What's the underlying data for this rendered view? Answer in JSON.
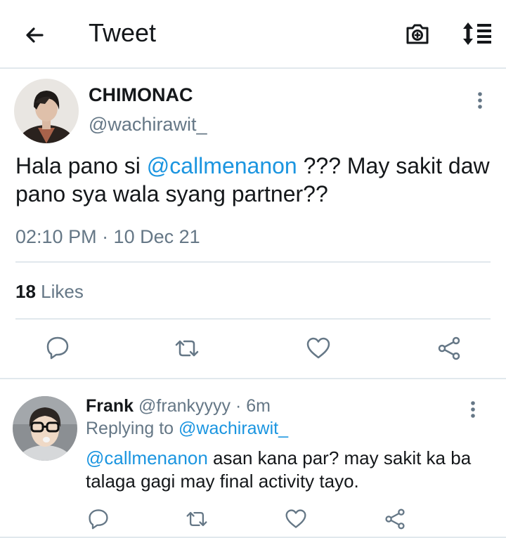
{
  "header": {
    "title": "Tweet",
    "icons": [
      "back-arrow-icon",
      "camera-icon",
      "sort-icon"
    ]
  },
  "tweet": {
    "author_name": "CHIMONAC",
    "author_handle": "@wachirawit_",
    "text_before": "Hala pano si ",
    "mention": "@callmenanon",
    "text_after": " ??? May sakit daw pano sya wala syang partner??",
    "timestamp": "02:10 PM · 10 Dec 21",
    "likes_count": "18",
    "likes_label": " Likes",
    "actions": [
      "reply-icon",
      "retweet-icon",
      "like-icon",
      "share-icon"
    ]
  },
  "reply": {
    "name": "Frank",
    "handle_time": " @frankyyyy · 6m",
    "replying_label": "Replying to ",
    "replying_handle": "@wachirawit_",
    "mention": "@callmenanon",
    "text": " asan kana par? may sakit ka ba talaga gagi may final activity tayo.",
    "actions": [
      "reply-icon",
      "retweet-icon",
      "like-icon",
      "share-icon"
    ]
  },
  "colors": {
    "accent": "#1b95e0",
    "secondary_text": "#657786",
    "divider": "#e1e8ed",
    "icon": "#657786"
  }
}
